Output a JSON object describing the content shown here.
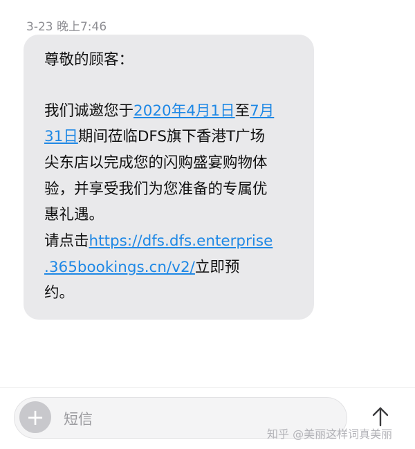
{
  "timestamp": "3-23 晚上7:46",
  "message": {
    "greeting": "尊敬的顾客：",
    "l1_pre": "我们诚邀您于",
    "l1_link": "2020年4月1日",
    "l1_mid": "至",
    "l1_link2": "7月",
    "l2_link": "31日",
    "l2_post": "期间莅临DFS旗下香港T广场",
    "l3": "尖东店以完成您的闪购盛宴购物体",
    "l4": "验，并享受我们为您准备的专属优",
    "l5": "惠礼遇。",
    "l6_pre": "请点击",
    "l6_link": "https://dfs.dfs.enterprise",
    "l7_link": ".365bookings.cn/v2/",
    "l7_post": "立即预",
    "l8": "约。"
  },
  "composer": {
    "placeholder": "短信",
    "add_icon": "plus-icon",
    "send_icon": "arrow-up-icon"
  },
  "watermark": "知乎 @美丽这样词真美丽",
  "colors": {
    "bubble": "#e9e9eb",
    "link": "#1e88e5",
    "text": "#111111",
    "timestamp": "#8e8e93"
  }
}
